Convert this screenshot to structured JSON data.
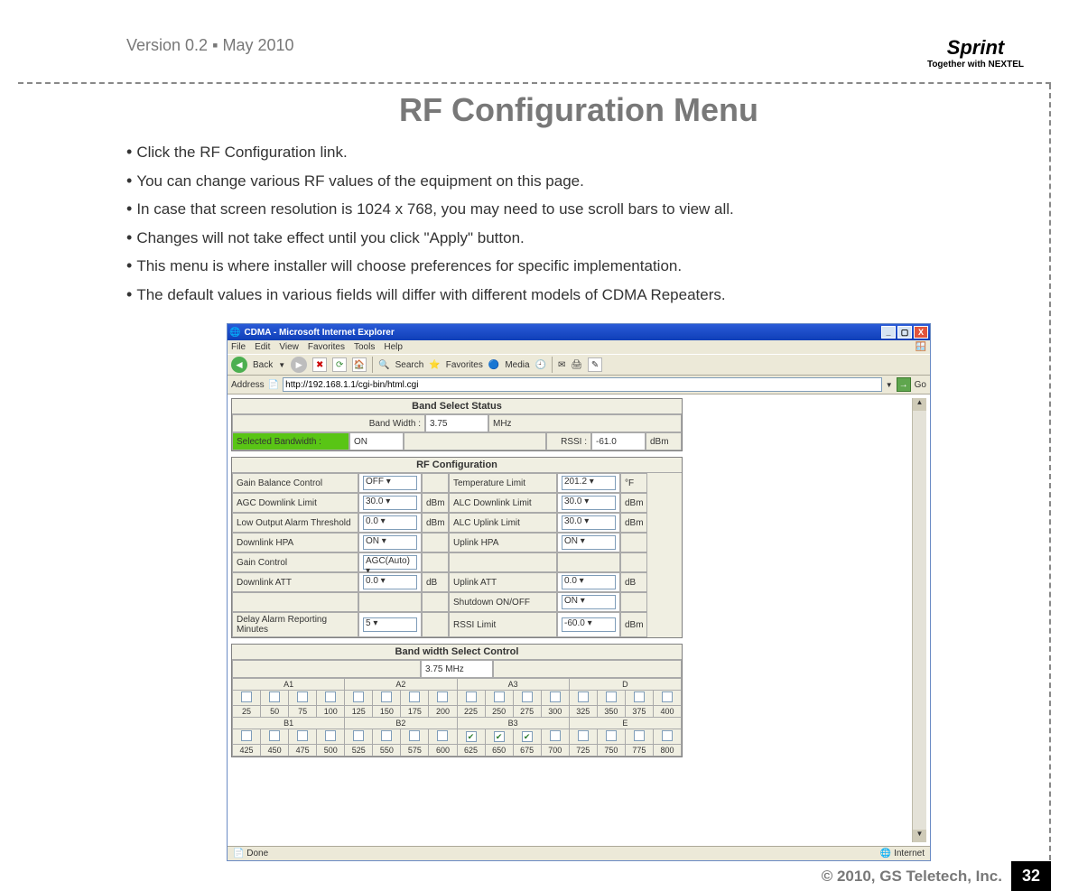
{
  "header": {
    "version": "Version 0.2 ▪ May 2010",
    "logo_main": "Sprint",
    "logo_sub": "Together with NEXTEL"
  },
  "title": "RF Configuration Menu",
  "bullets": [
    "Click the RF Configuration link.",
    "You can change various RF values of the equipment on this page.",
    "In case that screen resolution is 1024 x 768, you may need to use scroll bars to view all.",
    "Changes will not take effect until you click \"Apply\" button.",
    "This menu is where installer will choose preferences for specific implementation.",
    "The default values in various fields will differ with different models of CDMA Repeaters."
  ],
  "ie": {
    "title": "CDMA - Microsoft Internet Explorer",
    "menu": [
      "File",
      "Edit",
      "View",
      "Favorites",
      "Tools",
      "Help"
    ],
    "back": "Back",
    "search": "Search",
    "favorites": "Favorites",
    "media": "Media",
    "addr_label": "Address",
    "addr_value": "http://192.168.1.1/cgi-bin/html.cgi",
    "go": "Go",
    "status_done": "Done",
    "status_zone": "Internet"
  },
  "band_status": {
    "head": "Band Select Status",
    "bw_label": "Band Width :",
    "bw_value": "3.75",
    "bw_unit": "MHz",
    "sel_bw_label": "Selected Bandwidth :",
    "sel_bw_value": "ON",
    "rssi_label": "RSSI :",
    "rssi_value": "-61.0",
    "rssi_unit": "dBm"
  },
  "rf": {
    "head": "RF Configuration",
    "rows": [
      {
        "l1": "Gain Balance Control",
        "v1": "OFF",
        "u1": "",
        "l2": "Temperature Limit",
        "v2": "201.2",
        "u2": "°F"
      },
      {
        "l1": "AGC Downlink Limit",
        "v1": "30.0",
        "u1": "dBm",
        "l2": "ALC Downlink Limit",
        "v2": "30.0",
        "u2": "dBm"
      },
      {
        "l1": "Low Output Alarm Threshold",
        "v1": "0.0",
        "u1": "dBm",
        "l2": "ALC Uplink Limit",
        "v2": "30.0",
        "u2": "dBm"
      },
      {
        "l1": "Downlink HPA",
        "v1": "ON",
        "u1": "",
        "l2": "Uplink HPA",
        "v2": "ON",
        "u2": ""
      },
      {
        "l1": "Gain Control",
        "v1": "AGC(Auto)",
        "u1": "",
        "l2": "",
        "v2": "",
        "u2": ""
      },
      {
        "l1": "Downlink ATT",
        "v1": "0.0",
        "u1": "dB",
        "l2": "Uplink ATT",
        "v2": "0.0",
        "u2": "dB"
      },
      {
        "l1": "",
        "v1": "",
        "u1": "",
        "l2": "Shutdown ON/OFF",
        "v2": "ON",
        "u2": ""
      },
      {
        "l1": "Delay Alarm Reporting Minutes",
        "v1": "5",
        "u1": "",
        "l2": "RSSI Limit",
        "v2": "-60.0",
        "u2": "dBm"
      }
    ]
  },
  "bw_ctrl": {
    "head": "Band width Select Control",
    "value": "3.75 MHz",
    "groups_top": [
      "A1",
      "A2",
      "A3",
      "D"
    ],
    "nums_top": [
      "25",
      "50",
      "75",
      "100",
      "125",
      "150",
      "175",
      "200",
      "225",
      "250",
      "275",
      "300",
      "325",
      "350",
      "375",
      "400"
    ],
    "checks_top": [
      false,
      false,
      false,
      false,
      false,
      false,
      false,
      false,
      false,
      false,
      false,
      false,
      false,
      false,
      false,
      false
    ],
    "groups_bot": [
      "B1",
      "B2",
      "B3",
      "E"
    ],
    "nums_bot": [
      "425",
      "450",
      "475",
      "500",
      "525",
      "550",
      "575",
      "600",
      "625",
      "650",
      "675",
      "700",
      "725",
      "750",
      "775",
      "800"
    ],
    "checks_bot": [
      false,
      false,
      false,
      false,
      false,
      false,
      false,
      false,
      true,
      true,
      true,
      false,
      false,
      false,
      false,
      false
    ]
  },
  "footer": {
    "copy": "© 2010, GS Teletech, Inc.",
    "page": "32"
  }
}
